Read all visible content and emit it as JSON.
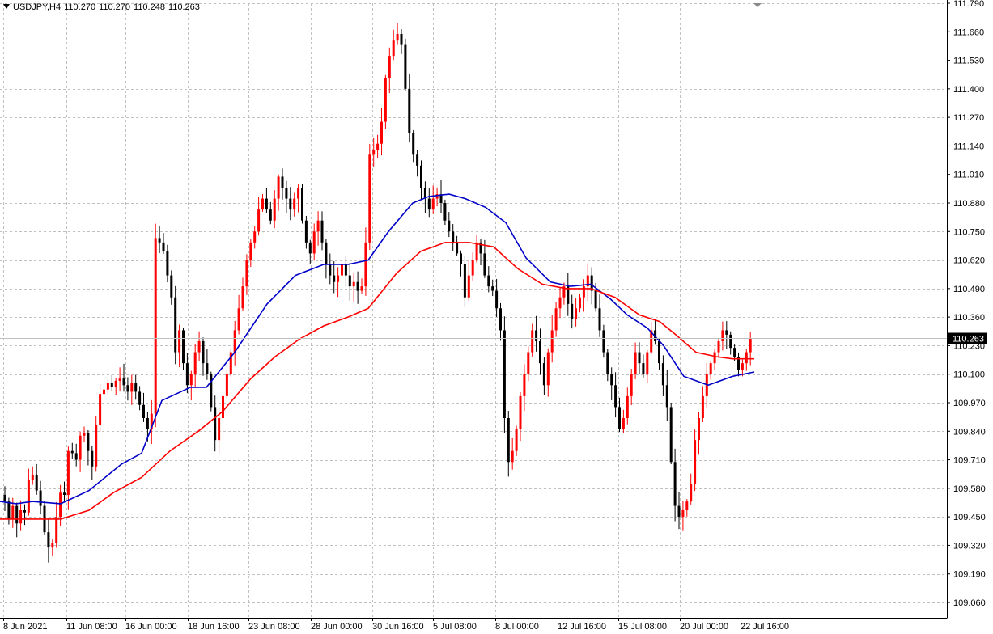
{
  "header": {
    "symbol": "USDJPY,H4",
    "open": "110.270",
    "high": "110.270",
    "low": "110.248",
    "close": "110.263"
  },
  "current_price": "110.263",
  "colors": {
    "bull": "#ff0000",
    "bear": "#000000",
    "ma_fast": "#0000c8",
    "ma_slow": "#ff0000",
    "grid": "#c0c0c0",
    "axis": "#000000",
    "price_line": "#c0c0c0",
    "price_box": "#000000"
  },
  "chart_data": {
    "type": "candlestick",
    "instrument": "USDJPY,H4",
    "ylim": [
      109.06,
      111.79
    ],
    "y_ticks": [
      "111.790",
      "111.660",
      "111.530",
      "111.400",
      "111.270",
      "111.140",
      "111.010",
      "110.880",
      "110.750",
      "110.620",
      "110.490",
      "110.360",
      "110.230",
      "110.100",
      "109.970",
      "109.840",
      "109.710",
      "109.580",
      "109.450",
      "109.320",
      "109.190",
      "109.060"
    ],
    "x_ticks": [
      "8 Jun 2021",
      "11 Jun 08:00",
      "16 Jun 00:00",
      "18 Jun 16:00",
      "23 Jun 08:00",
      "28 Jun 00:00",
      "30 Jun 16:00",
      "5 Jul 08:00",
      "8 Jul 00:00",
      "12 Jul 16:00",
      "15 Jul 08:00",
      "20 Jul 00:00",
      "22 Jul 16:00"
    ],
    "grid": true,
    "closes": [
      109.52,
      109.44,
      109.5,
      109.42,
      109.48,
      109.47,
      109.62,
      109.64,
      109.57,
      109.5,
      109.38,
      109.31,
      109.33,
      109.45,
      109.56,
      109.55,
      109.75,
      109.74,
      109.71,
      109.82,
      109.83,
      109.75,
      109.68,
      109.87,
      110.01,
      110.03,
      110.06,
      110.04,
      110.07,
      110.08,
      110.05,
      110.02,
      110.06,
      110.02,
      109.96,
      109.9,
      109.85,
      109.92,
      110.72,
      110.7,
      110.66,
      110.55,
      110.45,
      110.2,
      110.3,
      110.15,
      110.05,
      110.1,
      110.2,
      110.25,
      110.15,
      110.1,
      109.95,
      109.8,
      109.9,
      110.0,
      110.1,
      110.2,
      110.3,
      110.4,
      110.5,
      110.62,
      110.7,
      110.75,
      110.85,
      110.9,
      110.85,
      110.8,
      110.9,
      111.0,
      110.95,
      110.9,
      110.85,
      110.9,
      110.95,
      110.8,
      110.7,
      110.65,
      110.75,
      110.8,
      110.7,
      110.6,
      110.55,
      110.52,
      110.55,
      110.6,
      110.55,
      110.5,
      110.52,
      110.48,
      110.5,
      110.7,
      111.1,
      111.12,
      111.15,
      111.25,
      111.45,
      111.55,
      111.62,
      111.65,
      111.6,
      111.4,
      111.2,
      111.1,
      111.05,
      110.95,
      110.9,
      110.85,
      110.9,
      110.92,
      110.88,
      110.8,
      110.75,
      110.7,
      110.65,
      110.6,
      110.45,
      110.55,
      110.62,
      110.7,
      110.65,
      110.55,
      110.5,
      110.48,
      110.4,
      110.3,
      109.9,
      109.7,
      109.75,
      109.85,
      110.0,
      110.1,
      110.2,
      110.3,
      110.25,
      110.15,
      110.05,
      110.2,
      110.3,
      110.4,
      110.45,
      110.5,
      110.42,
      110.35,
      110.4,
      110.45,
      110.5,
      110.55,
      110.48,
      110.4,
      110.3,
      110.2,
      110.1,
      110.05,
      109.95,
      109.85,
      109.9,
      110.0,
      110.1,
      110.2,
      110.15,
      110.1,
      110.2,
      110.3,
      110.25,
      110.15,
      110.05,
      109.95,
      109.7,
      109.5,
      109.45,
      109.48,
      109.52,
      109.6,
      109.8,
      109.9,
      110.0,
      110.1,
      110.15,
      110.2,
      110.25,
      110.3,
      110.28,
      110.22,
      110.18,
      110.12,
      110.15,
      110.2,
      110.263
    ],
    "series": [
      {
        "type": "ma",
        "points": [
          [
            0,
            109.52
          ],
          [
            20,
            109.51
          ],
          [
            40,
            109.52
          ],
          [
            75,
            109.51
          ],
          [
            110,
            109.57
          ],
          [
            150,
            109.69
          ],
          [
            175,
            109.74
          ],
          [
            200,
            109.98
          ],
          [
            235,
            110.04
          ],
          [
            255,
            110.04
          ],
          [
            290,
            110.2
          ],
          [
            330,
            110.42
          ],
          [
            365,
            110.55
          ],
          [
            400,
            110.6
          ],
          [
            430,
            110.6
          ],
          [
            455,
            110.62
          ],
          [
            480,
            110.75
          ],
          [
            510,
            110.88
          ],
          [
            530,
            110.91
          ],
          [
            555,
            110.92
          ],
          [
            575,
            110.9
          ],
          [
            600,
            110.86
          ],
          [
            625,
            110.79
          ],
          [
            650,
            110.63
          ],
          [
            680,
            110.52
          ],
          [
            705,
            110.5
          ],
          [
            730,
            110.51
          ],
          [
            755,
            110.44
          ],
          [
            775,
            110.37
          ],
          [
            800,
            110.31
          ],
          [
            820,
            110.23
          ],
          [
            845,
            110.09
          ],
          [
            875,
            110.05
          ],
          [
            905,
            110.09
          ],
          [
            932,
            110.11
          ]
        ]
      },
      {
        "type": "ma",
        "points": [
          [
            0,
            109.44
          ],
          [
            40,
            109.44
          ],
          [
            75,
            109.44
          ],
          [
            110,
            109.48
          ],
          [
            140,
            109.56
          ],
          [
            175,
            109.63
          ],
          [
            210,
            109.75
          ],
          [
            245,
            109.84
          ],
          [
            275,
            109.93
          ],
          [
            310,
            110.08
          ],
          [
            340,
            110.18
          ],
          [
            370,
            110.26
          ],
          [
            400,
            110.32
          ],
          [
            430,
            110.36
          ],
          [
            455,
            110.4
          ],
          [
            490,
            110.56
          ],
          [
            520,
            110.66
          ],
          [
            550,
            110.7
          ],
          [
            580,
            110.7
          ],
          [
            610,
            110.68
          ],
          [
            640,
            110.58
          ],
          [
            670,
            110.51
          ],
          [
            700,
            110.49
          ],
          [
            730,
            110.49
          ],
          [
            760,
            110.45
          ],
          [
            790,
            110.37
          ],
          [
            815,
            110.34
          ],
          [
            835,
            110.28
          ],
          [
            860,
            110.2
          ],
          [
            885,
            110.18
          ],
          [
            905,
            110.17
          ],
          [
            932,
            110.17
          ]
        ]
      }
    ]
  }
}
